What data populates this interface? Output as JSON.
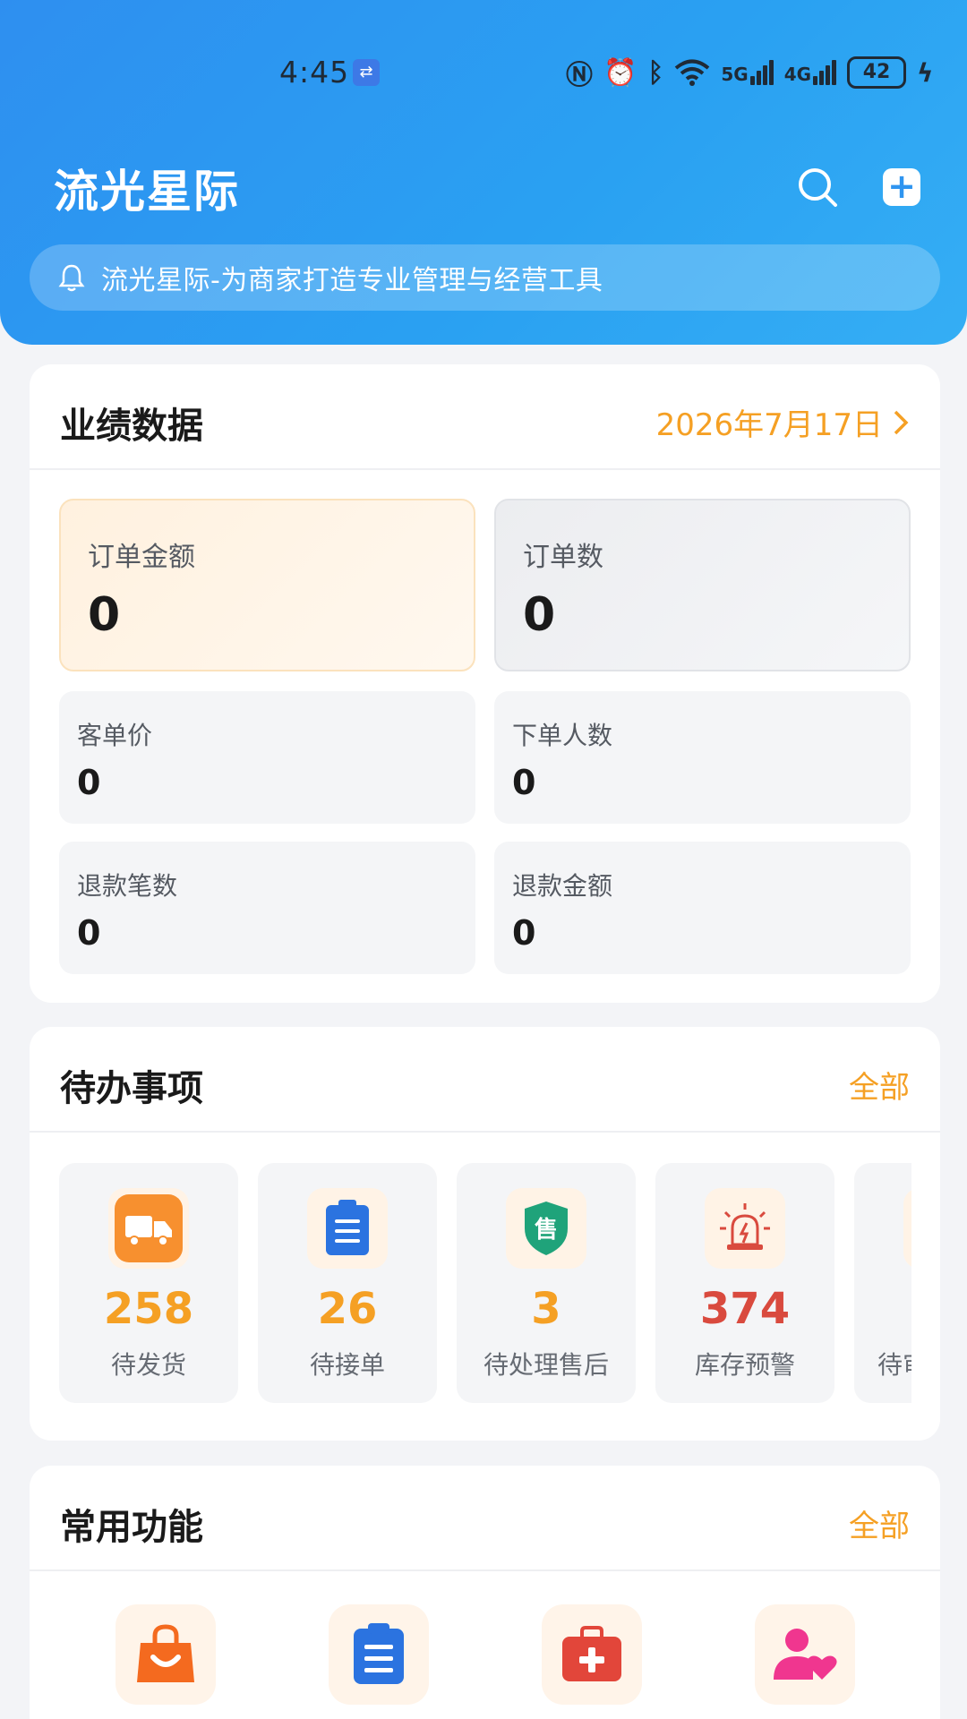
{
  "status_bar": {
    "time": "4:45",
    "signal1": "5G",
    "signal2": "4G",
    "battery": "42"
  },
  "header": {
    "title": "流光星际",
    "notice": "流光星际-为商家打造专业管理与经营工具"
  },
  "performance": {
    "title": "业绩数据",
    "date": "2026年7月17日",
    "tiles": [
      {
        "label": "订单金额",
        "value": "0"
      },
      {
        "label": "订单数",
        "value": "0"
      },
      {
        "label": "客单价",
        "value": "0"
      },
      {
        "label": "下单人数",
        "value": "0"
      },
      {
        "label": "退款笔数",
        "value": "0"
      },
      {
        "label": "退款金额",
        "value": "0"
      }
    ]
  },
  "todo": {
    "title": "待办事项",
    "all": "全部",
    "items": [
      {
        "count": "258",
        "label": "待发货",
        "icon": "truck-icon",
        "color": "#f5a024"
      },
      {
        "count": "26",
        "label": "待接单",
        "icon": "clipboard-icon",
        "color": "#f5a024"
      },
      {
        "count": "3",
        "label": "待处理售后",
        "icon": "after-sale-shield-icon",
        "color": "#f5a024"
      },
      {
        "count": "374",
        "label": "库存预警",
        "icon": "alarm-light-icon",
        "color": "#d94a3e"
      },
      {
        "count": "",
        "label": "待审",
        "icon": "partial-icon",
        "color": "#f5a024"
      }
    ]
  },
  "common": {
    "title": "常用功能",
    "all": "全部",
    "items": [
      {
        "icon": "shopping-bag-icon"
      },
      {
        "icon": "clipboard-list-icon"
      },
      {
        "icon": "first-aid-kit-icon"
      },
      {
        "icon": "user-heart-icon"
      }
    ]
  },
  "colors": {
    "accent_blue": "#2e8ff0",
    "accent_orange": "#f5a024",
    "alert_red": "#d94a3e"
  }
}
